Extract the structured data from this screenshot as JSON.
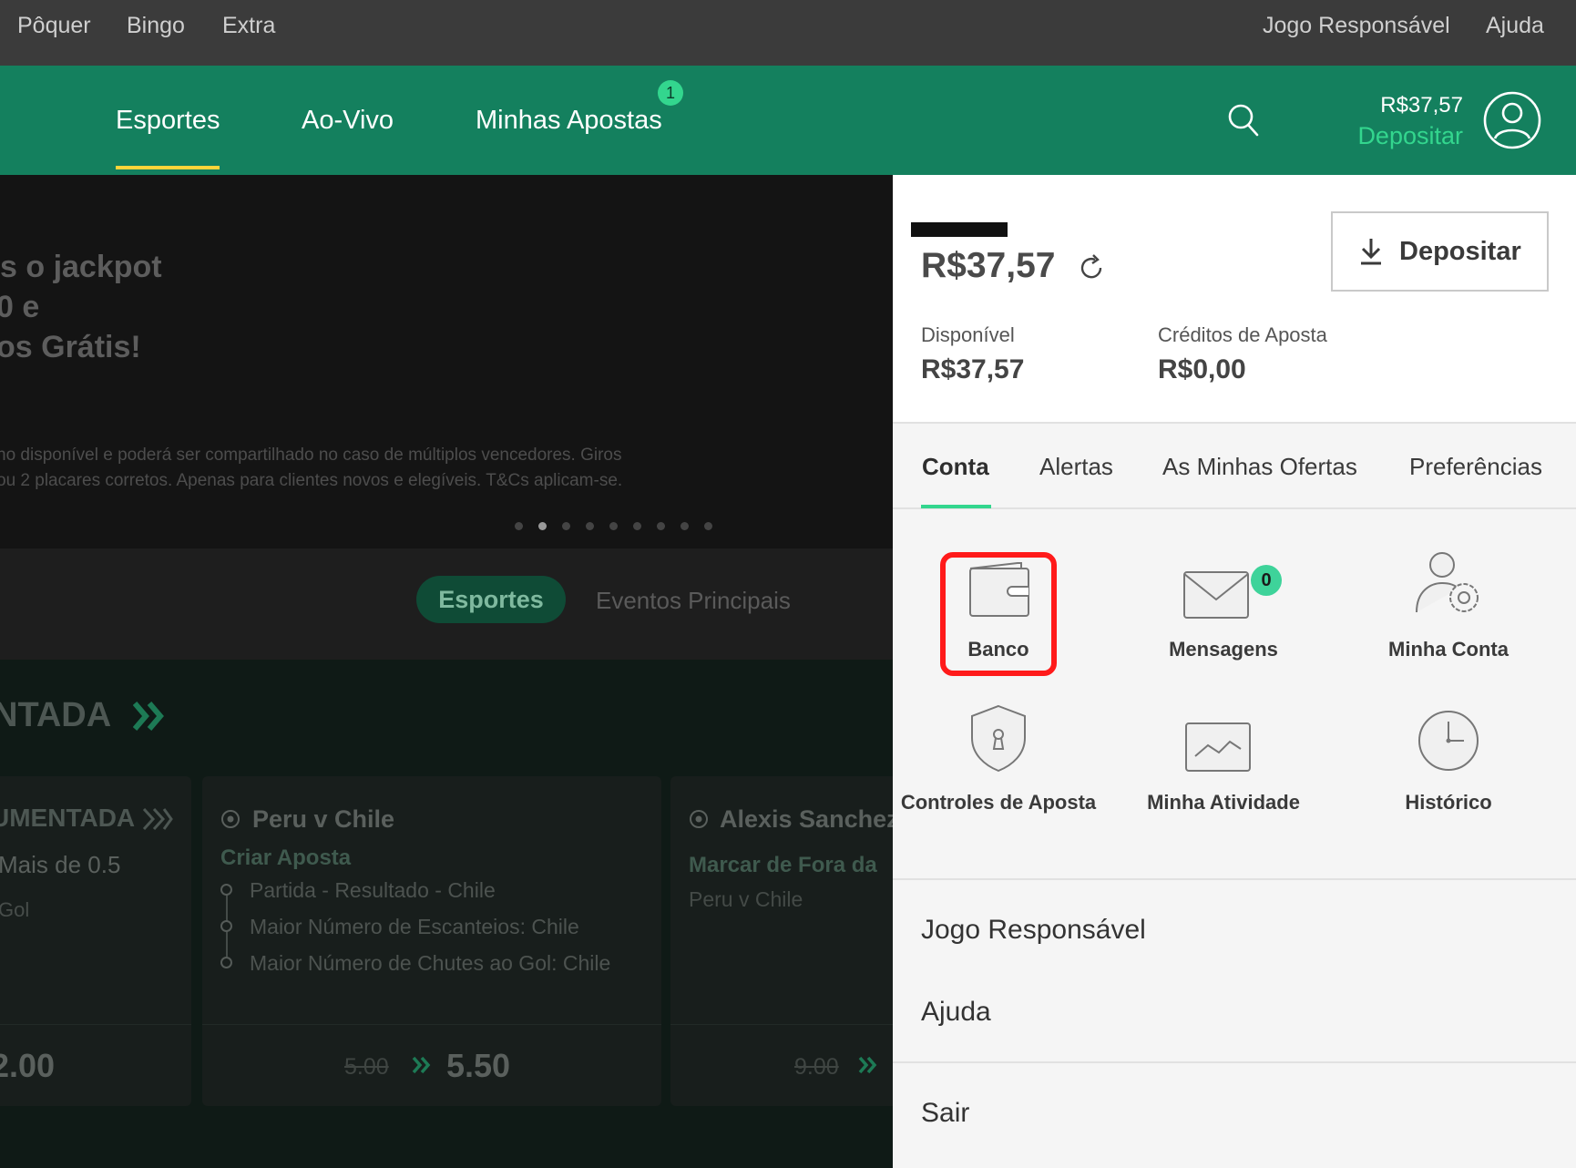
{
  "topbar": {
    "left_items": [
      "Pôquer",
      "Bingo",
      "Extra"
    ],
    "right_items": [
      "Jogo Responsável",
      "Ajuda"
    ]
  },
  "nav": {
    "tabs": [
      "Esportes",
      "Ao-Vivo",
      "Minhas Apostas"
    ],
    "active_tab": "Esportes",
    "bets_badge": "1",
    "balance": "R$37,57",
    "deposit_label": "Depositar",
    "search_icon": "search-icon",
    "account_icon": "user-circle-icon"
  },
  "background": {
    "hero_lines": [
      "s o jackpot",
      "0 e",
      "os Grátis!"
    ],
    "hero_terms": [
      "no disponível e poderá ser compartilhado no caso de múltiplos vencedores. Giros",
      "ou 2 placares corretos. Apenas para clientes novos e elegíveis. T&Cs aplicam-se."
    ],
    "carousel_dots": 9,
    "carousel_active_index": 1,
    "pills": [
      "Esportes",
      "Eventos Principais"
    ],
    "featured_title": "NTADA",
    "cards": [
      {
        "header": "UMENTADA",
        "line1": "Mais de 0.5",
        "line2": "Gol",
        "odds_new": "2.00"
      },
      {
        "header": "Peru v Chile",
        "sub": "Criar Aposta",
        "legs": [
          "Partida - Resultado - Chile",
          "Maior Número de Escanteios: Chile",
          "Maior Número de Chutes ao Gol: Chile"
        ],
        "odds_old": "5.00",
        "odds_new": "5.50"
      },
      {
        "header": "Alexis Sanchez",
        "sub": "Marcar de Fora da",
        "line2": "Peru v Chile",
        "odds_old": "9.00"
      }
    ]
  },
  "panel": {
    "balance": "R$37,57",
    "deposit_button": "Depositar",
    "available_label": "Disponível",
    "available_value": "R$37,57",
    "credits_label": "Créditos de Aposta",
    "credits_value": "R$0,00",
    "tabs": [
      "Conta",
      "Alertas",
      "As Minhas Ofertas",
      "Preferências"
    ],
    "active_tab": "Conta",
    "tiles": [
      {
        "label": "Banco",
        "icon": "wallet-icon"
      },
      {
        "label": "Mensagens",
        "icon": "envelope-icon",
        "badge": "0"
      },
      {
        "label": "Minha Conta",
        "icon": "user-settings-icon"
      },
      {
        "label": "Controles de Aposta",
        "icon": "shield-lock-icon"
      },
      {
        "label": "Minha Atividade",
        "icon": "activity-chart-icon"
      },
      {
        "label": "Histórico",
        "icon": "clock-icon"
      }
    ],
    "links": [
      "Jogo Responsável",
      "Ajuda"
    ],
    "logout": "Sair"
  }
}
